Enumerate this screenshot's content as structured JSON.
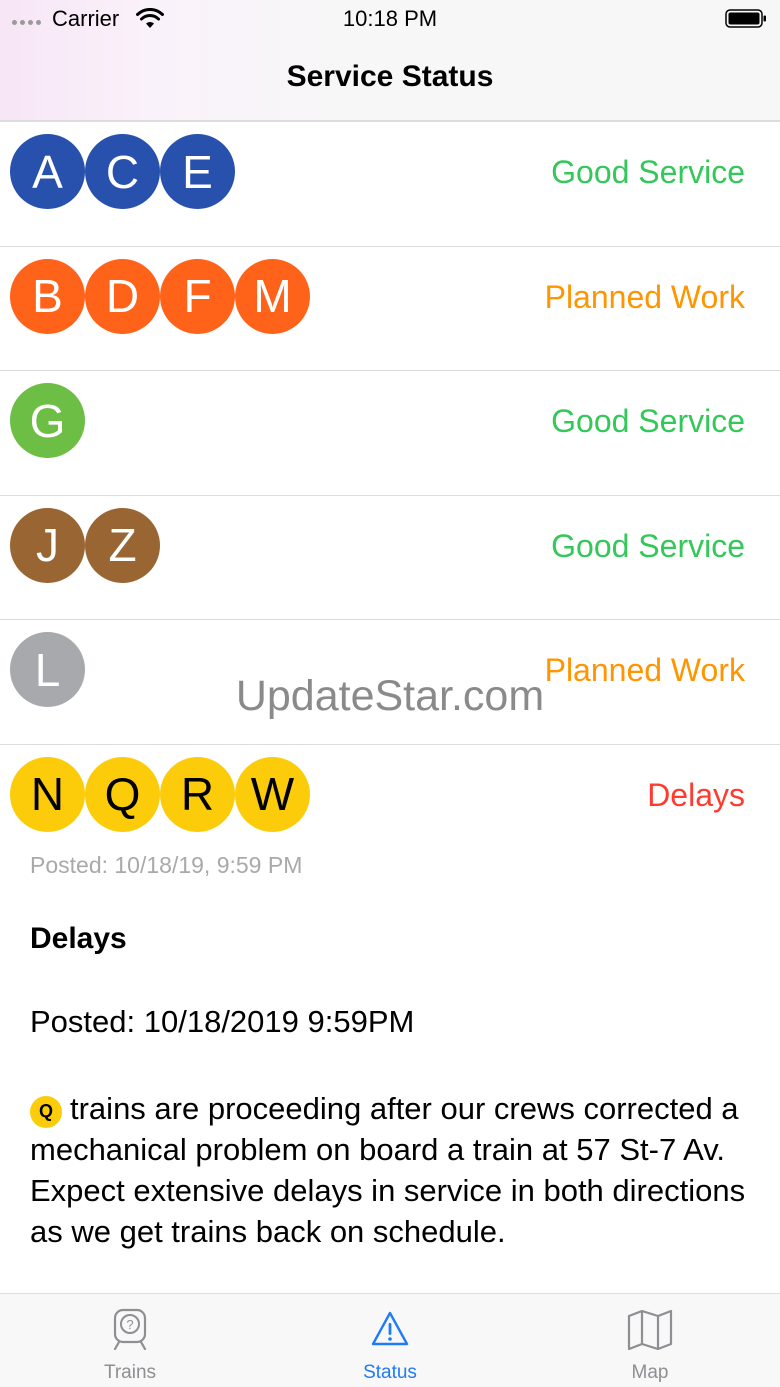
{
  "status_bar": {
    "carrier": "Carrier",
    "time": "10:18 PM"
  },
  "nav": {
    "title": "Service Status"
  },
  "rows": [
    {
      "lines": [
        "A",
        "C",
        "E"
      ],
      "status": "Good Service",
      "bullet_color": "#2850ad",
      "status_color": "#34c759"
    },
    {
      "lines": [
        "B",
        "D",
        "F",
        "M"
      ],
      "status": "Planned Work",
      "bullet_color": "#ff6319",
      "status_color": "#ff9500"
    },
    {
      "lines": [
        "G"
      ],
      "status": "Good Service",
      "bullet_color": "#6cbe45",
      "status_color": "#34c759"
    },
    {
      "lines": [
        "J",
        "Z"
      ],
      "status": "Good Service",
      "bullet_color": "#996633",
      "status_color": "#34c759"
    },
    {
      "lines": [
        "L"
      ],
      "status": "Planned Work",
      "bullet_color": "#a7a9ac",
      "status_color": "#ff9500"
    },
    {
      "lines": [
        "N",
        "Q",
        "R",
        "W"
      ],
      "status": "Delays",
      "bullet_color": "#fccc0a",
      "status_color": "#ff3b30"
    }
  ],
  "detail": {
    "posted_small": "Posted: 10/18/19, 9:59 PM",
    "title": "Delays",
    "posted": "Posted: 10/18/2019 9:59PM",
    "inline_line": "Q",
    "body": "trains are proceeding after our crews corrected a mechanical problem on board a train at 57 St-7 Av. Expect extensive delays in service in both directions as we get trains back on schedule."
  },
  "watermark": "UpdateStar.com",
  "tabs": [
    {
      "label": "Trains",
      "icon": "train-icon"
    },
    {
      "label": "Status",
      "icon": "warning-icon"
    },
    {
      "label": "Map",
      "icon": "map-icon"
    }
  ],
  "colors": {
    "accent": "#1f7bf6",
    "inactive_tab": "#8e8e93"
  }
}
